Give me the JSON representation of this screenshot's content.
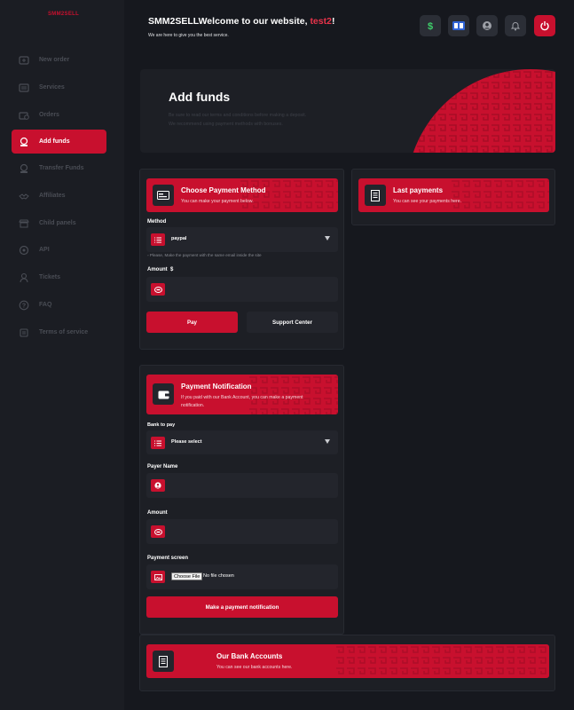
{
  "brand": "SMM2SELL",
  "sidebar": {
    "items": [
      {
        "label": "New order",
        "icon": "cart-icon"
      },
      {
        "label": "Services",
        "icon": "list-icon"
      },
      {
        "label": "Orders",
        "icon": "orders-icon"
      },
      {
        "label": "Add funds",
        "icon": "wallet-icon",
        "active": true
      },
      {
        "label": "Transfer Funds",
        "icon": "transfer-icon"
      },
      {
        "label": "Affiliates",
        "icon": "handshake-icon"
      },
      {
        "label": "Child panels",
        "icon": "store-icon"
      },
      {
        "label": "API",
        "icon": "api-icon"
      },
      {
        "label": "Tickets",
        "icon": "ticket-icon"
      },
      {
        "label": "FAQ",
        "icon": "question-icon"
      },
      {
        "label": "Terms of service",
        "icon": "scroll-icon"
      }
    ]
  },
  "header": {
    "title_prefix": "SMM2SELLWelcome to our website, ",
    "username": "test2",
    "title_suffix": "!",
    "subtitle": "We are here to give you the best service."
  },
  "hero": {
    "title": "Add funds",
    "line1": "Be sure to read our terms and conditions before making a deposit.",
    "line2": "We recommend using payment methods with bonuses."
  },
  "payment_method": {
    "title": "Choose Payment Method",
    "subtitle": "You can make your payment below.",
    "method_label": "Method",
    "method_value": "paypal",
    "hint": "Please, Make the payment with the same email inside the site",
    "amount_label": "Amount",
    "amount_currency": "$",
    "pay_button": "Pay",
    "support_button": "Support Center"
  },
  "last_payments": {
    "title": "Last payments",
    "subtitle": "You can see your payments here."
  },
  "notification": {
    "title": "Payment Notification",
    "subtitle_line1": "If you paid with our Bank Account, you can make a payment",
    "subtitle_line2": "notification.",
    "bank_label": "Bank to pay",
    "bank_value": "Please select",
    "payer_label": "Payer Name",
    "amount_label": "Amount",
    "screen_label": "Payment screen",
    "file_button": "Choose File",
    "file_text": "No file chosen",
    "submit_button": "Make a payment notification"
  },
  "bank_accounts": {
    "title": "Our Bank Accounts",
    "subtitle": "You can see our bank accounts here."
  },
  "colors": {
    "accent": "#c8102e",
    "background": "#16181e",
    "panel": "#1d1f25",
    "sidebar": "#1b1d23"
  }
}
